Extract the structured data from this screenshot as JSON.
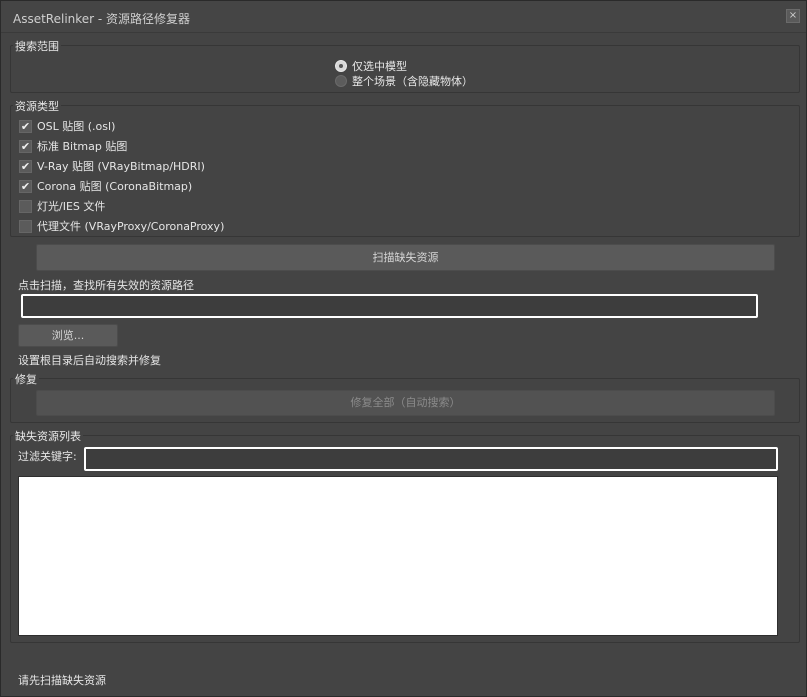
{
  "window": {
    "title": "AssetRelinker - 资源路径修复器",
    "close_glyph": "×"
  },
  "search_scope": {
    "label": "搜索范围",
    "options": [
      {
        "label": "仅选中模型",
        "selected": true
      },
      {
        "label": "整个场景（含隐藏物体）",
        "selected": false
      }
    ]
  },
  "asset_types": {
    "label": "资源类型",
    "items": [
      {
        "label": "OSL 贴图 (.osl)",
        "checked": true
      },
      {
        "label": "标准 Bitmap 贴图",
        "checked": true
      },
      {
        "label": "V-Ray 贴图 (VRayBitmap/HDRI)",
        "checked": true
      },
      {
        "label": "Corona 贴图 (CoronaBitmap)",
        "checked": true
      },
      {
        "label": "灯光/IES 文件",
        "checked": false
      },
      {
        "label": "代理文件 (VRayProxy/CoronaProxy)",
        "checked": false
      }
    ]
  },
  "scan": {
    "button_label": "扫描缺失资源",
    "hint": "点击扫描，查找所有失效的资源路径",
    "path_value": "",
    "browse_label": "浏览...",
    "browse_hint": "设置根目录后自动搜索并修复"
  },
  "repair": {
    "label": "修复",
    "button_label": "修复全部（自动搜索）"
  },
  "missing_list": {
    "label": "缺失资源列表",
    "filter_label": "过滤关键字:",
    "filter_value": "",
    "items": []
  },
  "status": {
    "text": "请先扫描缺失资源"
  },
  "colors": {
    "window_bg": "#444444",
    "input_border": "#ffffff",
    "list_bg": "#ffffff"
  }
}
